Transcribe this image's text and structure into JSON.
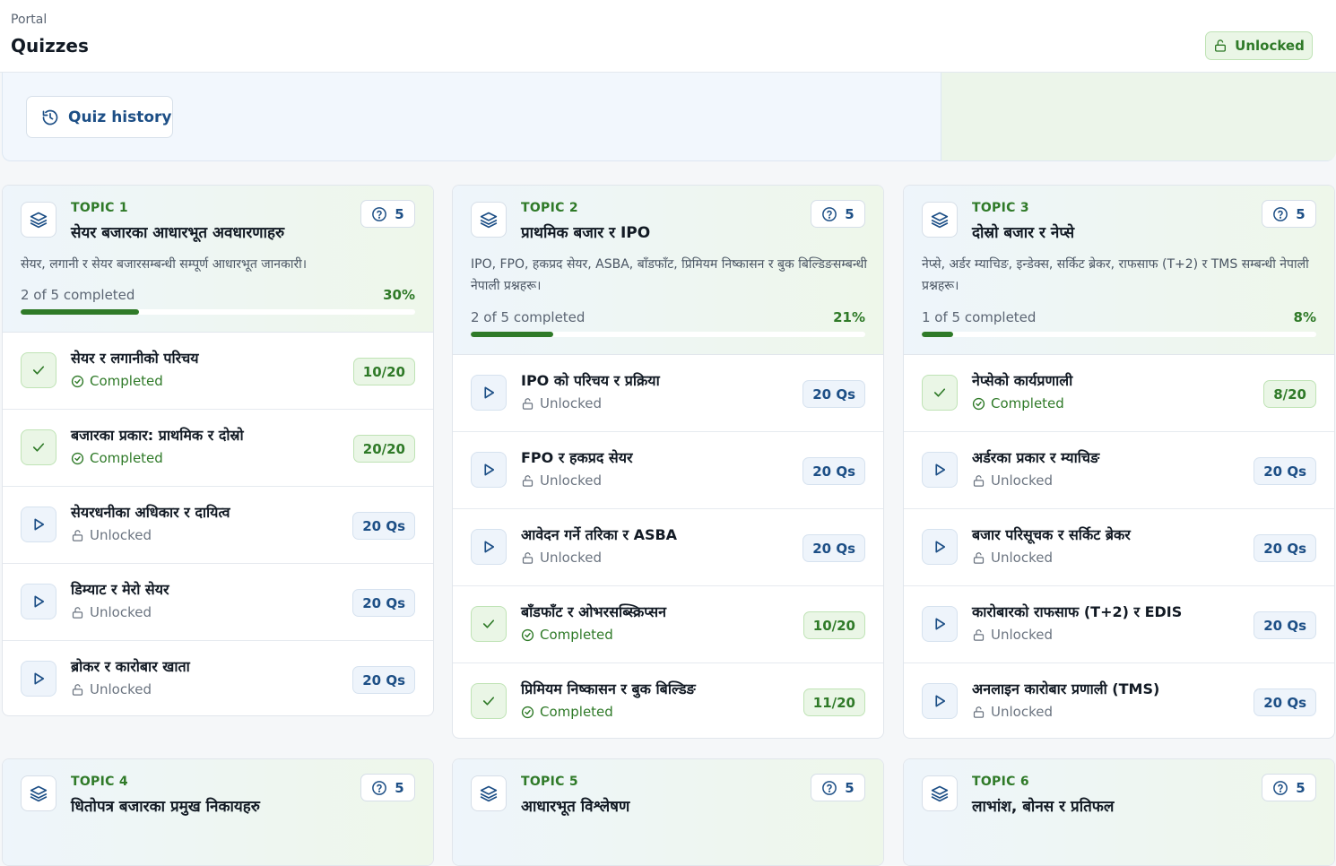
{
  "header": {
    "breadcrumb": "Portal",
    "title": "Quizzes",
    "status_label": "Unlocked"
  },
  "hero": {
    "history_button": "Quiz history"
  },
  "topics": [
    {
      "label": "TOPIC 1",
      "title": "सेयर बजारका आधारभूत अवधारणाहरु",
      "count": "5",
      "description": "सेयर, लगानी र सेयर बजारसम्बन्धी सम्पूर्ण आधारभूत जानकारी।",
      "progress_text": "2 of 5 completed",
      "progress_pct": "30%",
      "progress_value": 30,
      "quizzes": [
        {
          "title": "सेयर र लगानीको परिचय",
          "status": "Completed",
          "done": true,
          "score": "10/20"
        },
        {
          "title": "बजारका प्रकार: प्राथमिक र दोस्रो",
          "status": "Completed",
          "done": true,
          "score": "20/20"
        },
        {
          "title": "सेयरधनीका अधिकार र दायित्व",
          "status": "Unlocked",
          "done": false,
          "score": "20 Qs"
        },
        {
          "title": "डिम्याट र मेरो सेयर",
          "status": "Unlocked",
          "done": false,
          "score": "20 Qs"
        },
        {
          "title": "ब्रोकर र कारोबार खाता",
          "status": "Unlocked",
          "done": false,
          "score": "20 Qs"
        }
      ]
    },
    {
      "label": "TOPIC 2",
      "title": "प्राथमिक बजार र IPO",
      "count": "5",
      "description": "IPO, FPO, हकप्रद सेयर, ASBA, बाँडफाँट, प्रिमियम निष्कासन र बुक बिल्डिङसम्बन्धी नेपाली प्रश्नहरू।",
      "progress_text": "2 of 5 completed",
      "progress_pct": "21%",
      "progress_value": 21,
      "quizzes": [
        {
          "title": "IPO को परिचय र प्रक्रिया",
          "status": "Unlocked",
          "done": false,
          "score": "20 Qs"
        },
        {
          "title": "FPO र हकप्रद सेयर",
          "status": "Unlocked",
          "done": false,
          "score": "20 Qs"
        },
        {
          "title": "आवेदन गर्ने तरिका र ASBA",
          "status": "Unlocked",
          "done": false,
          "score": "20 Qs"
        },
        {
          "title": "बाँडफाँट र ओभरसब्स्क्रिप्सन",
          "status": "Completed",
          "done": true,
          "score": "10/20"
        },
        {
          "title": "प्रिमियम निष्कासन र बुक बिल्डिङ",
          "status": "Completed",
          "done": true,
          "score": "11/20"
        }
      ]
    },
    {
      "label": "TOPIC 3",
      "title": "दोस्रो बजार र नेप्से",
      "count": "5",
      "description": "नेप्से, अर्डर म्याचिङ, इन्डेक्स, सर्किट ब्रेकर, राफसाफ (T+2) र TMS सम्बन्धी नेपाली प्रश्नहरू।",
      "progress_text": "1 of 5 completed",
      "progress_pct": "8%",
      "progress_value": 8,
      "quizzes": [
        {
          "title": "नेप्सेको कार्यप्रणाली",
          "status": "Completed",
          "done": true,
          "score": "8/20"
        },
        {
          "title": "अर्डरका प्रकार र म्याचिङ",
          "status": "Unlocked",
          "done": false,
          "score": "20 Qs"
        },
        {
          "title": "बजार परिसूचक र सर्किट ब्रेकर",
          "status": "Unlocked",
          "done": false,
          "score": "20 Qs"
        },
        {
          "title": "कारोबारको राफसाफ (T+2) र EDIS",
          "status": "Unlocked",
          "done": false,
          "score": "20 Qs"
        },
        {
          "title": "अनलाइन कारोबार प्रणाली (TMS)",
          "status": "Unlocked",
          "done": false,
          "score": "20 Qs"
        }
      ]
    },
    {
      "label": "TOPIC 4",
      "title": "धितोपत्र बजारका प्रमुख निकायहरु",
      "count": "5"
    },
    {
      "label": "TOPIC 5",
      "title": "आधारभूत विश्लेषण",
      "count": "5"
    },
    {
      "label": "TOPIC 6",
      "title": "लाभांश, बोनस र प्रतिफल",
      "count": "5"
    }
  ]
}
